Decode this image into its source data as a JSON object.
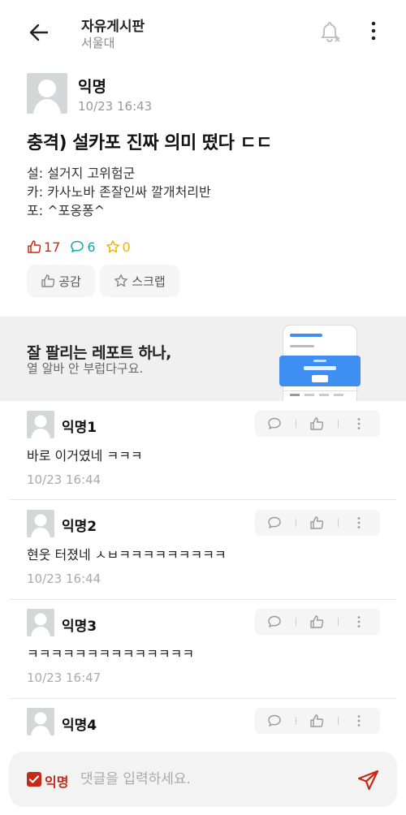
{
  "header": {
    "title": "자유게시판",
    "subtitle": "서울대"
  },
  "post": {
    "author": "익명",
    "time": "10/23 16:43",
    "title": "충격) 설카포 진짜 의미 떴다 ㄷㄷ",
    "body": [
      "설: 설거지 고위험군",
      "카: 카사노바 존잘인싸 깔개처리반",
      "포: ^포옹퐁^"
    ],
    "likes": "17",
    "comments": "6",
    "scraps": "0",
    "like_button": "공감",
    "scrap_button": "스크랩"
  },
  "ad": {
    "title": "잘 팔리는 레포트 하나,",
    "subtitle": "열 알바 안 부럽다구요."
  },
  "comments": [
    {
      "author": "익명1",
      "text": "바로 이거였네 ㅋㅋㅋ",
      "time": "10/23 16:44"
    },
    {
      "author": "익명2",
      "text": "현웃 터졌네 ㅅㅂㅋㅋㅋㅋㅋㅋㅋㅋㅋ",
      "time": "10/23 16:44"
    },
    {
      "author": "익명3",
      "text": "ㅋㅋㅋㅋㅋㅋㅋㅋㅋㅋㅋㅋㅋㅋ",
      "time": "10/23 16:47"
    },
    {
      "author": "익명4",
      "text": "",
      "time": ""
    }
  ],
  "input": {
    "anonymous_label": "익명",
    "placeholder": "댓글을 입력하세요."
  },
  "colors": {
    "accent_red": "#c62917",
    "comment_teal": "#0ca5b0",
    "scrap_yellow": "#f2b200"
  }
}
